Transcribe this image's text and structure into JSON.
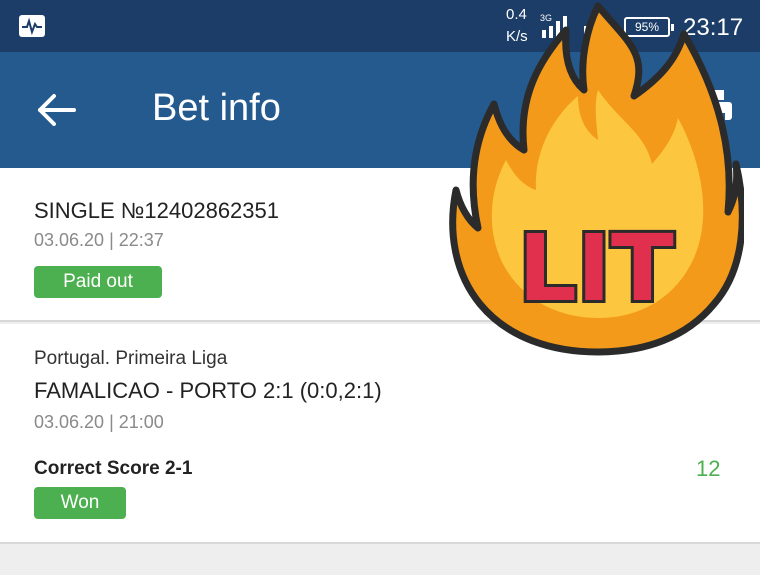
{
  "status_bar": {
    "net_speed_value": "0.4",
    "net_speed_unit": "K/s",
    "network_type": "3G",
    "battery": "95%",
    "time": "23:17"
  },
  "app_bar": {
    "title": "Bet info"
  },
  "bet": {
    "type_number": "SINGLE №12402862351",
    "datetime": "03.06.20 | 22:37",
    "status": "Paid out"
  },
  "event": {
    "league": "Portugal. Primeira Liga",
    "match": "FAMALICAO - PORTO 2:1 (0:0,2:1)",
    "datetime": "03.06.20 | 21:00",
    "market": "Correct Score 2-1",
    "odds": "12",
    "result": "Won"
  },
  "sticker": {
    "text": "LIT"
  },
  "colors": {
    "status_bar": "#1b3d68",
    "app_bar": "#255a8f",
    "badge_green": "#4caf50",
    "odds_green": "#4caf50",
    "sticker_text": "#e0304e"
  },
  "icons": [
    "activity-icon",
    "signal-icon",
    "battery-icon",
    "back-arrow-icon",
    "printer-icon",
    "fire-icon"
  ]
}
